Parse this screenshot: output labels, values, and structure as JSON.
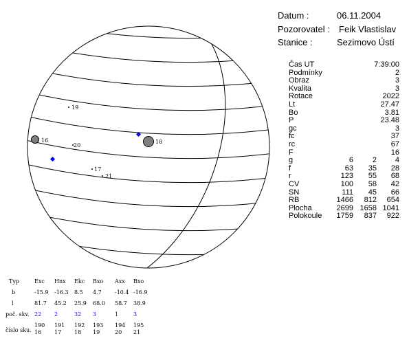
{
  "header": {
    "datum_label": "Datum :",
    "datum_value": "06.11.2004",
    "observer_label": "Pozorovatel :",
    "observer_value": "Feik Vlastislav",
    "station_label": "Stanice :",
    "station_value": "Sezimovo Ústí"
  },
  "params": [
    {
      "label": "Čas UT",
      "values": [
        "7:39:00"
      ]
    },
    {
      "label": "Podmínky",
      "values": [
        "2"
      ]
    },
    {
      "label": "Obraz",
      "values": [
        "3"
      ]
    },
    {
      "label": "Kvalita",
      "values": [
        "3"
      ]
    },
    {
      "label": "Rotace",
      "values": [
        "2022"
      ]
    },
    {
      "label": "Lt",
      "values": [
        "27.47"
      ]
    },
    {
      "label": "Bo",
      "values": [
        "3.81"
      ]
    },
    {
      "label": "P",
      "values": [
        "23.48"
      ]
    },
    {
      "label": "gc",
      "values": [
        "3"
      ]
    },
    {
      "label": "fc",
      "values": [
        "37"
      ]
    },
    {
      "label": "rc",
      "values": [
        "67"
      ]
    },
    {
      "label": "F",
      "values": [
        "16"
      ]
    },
    {
      "label": "g",
      "values": [
        "6",
        "2",
        "4"
      ]
    },
    {
      "label": "f",
      "values": [
        "63",
        "35",
        "28"
      ]
    },
    {
      "label": "r",
      "values": [
        "123",
        "55",
        "68"
      ]
    },
    {
      "label": "CV",
      "values": [
        "100",
        "58",
        "42"
      ]
    },
    {
      "label": "SN",
      "values": [
        "111",
        "45",
        "66"
      ]
    },
    {
      "label": "RB",
      "values": [
        "1466",
        "812",
        "654"
      ]
    },
    {
      "label": "Plocha",
      "values": [
        "2699",
        "1658",
        "1041"
      ]
    },
    {
      "label": "Polokoule",
      "values": [
        "1759",
        "837",
        "922"
      ]
    }
  ],
  "disk_labels": [
    "19",
    "16",
    "20",
    "18",
    "17",
    "21"
  ],
  "bottom_table": {
    "header": [
      "Typ",
      "Exc",
      "Hnx",
      "Ekc",
      "Bxo",
      "Axx",
      "Bxo"
    ],
    "b_row": [
      "b",
      "-15.9",
      "-16.3",
      "8.5",
      "4.7",
      "-10.4",
      "-16.9"
    ],
    "l_row": [
      "l",
      "81.7",
      "45.2",
      "25.9",
      "68.0",
      "58.7",
      "38.9"
    ],
    "poc_row": [
      "poč. skv.",
      "22",
      "2",
      "32",
      "3",
      "1",
      "3"
    ],
    "cislo_label": "číslo sku.",
    "cislo_row1": [
      "190",
      "191",
      "192",
      "193",
      "194",
      "195"
    ],
    "cislo_row2": [
      "16",
      "17",
      "18",
      "19",
      "20",
      "21"
    ]
  },
  "colors": {
    "blue": "#0000ff",
    "spot": "#808080"
  }
}
